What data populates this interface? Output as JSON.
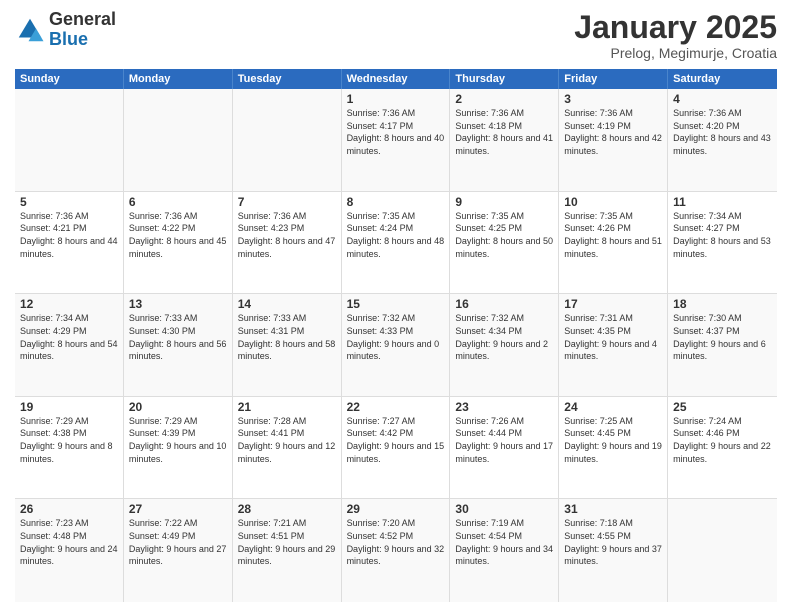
{
  "header": {
    "logo_line1": "General",
    "logo_line2": "Blue",
    "title": "January 2025",
    "subtitle": "Prelog, Megimurje, Croatia"
  },
  "days_of_week": [
    "Sunday",
    "Monday",
    "Tuesday",
    "Wednesday",
    "Thursday",
    "Friday",
    "Saturday"
  ],
  "weeks": [
    [
      {
        "day": "",
        "sunrise": "",
        "sunset": "",
        "daylight": ""
      },
      {
        "day": "",
        "sunrise": "",
        "sunset": "",
        "daylight": ""
      },
      {
        "day": "",
        "sunrise": "",
        "sunset": "",
        "daylight": ""
      },
      {
        "day": "1",
        "sunrise": "Sunrise: 7:36 AM",
        "sunset": "Sunset: 4:17 PM",
        "daylight": "Daylight: 8 hours and 40 minutes."
      },
      {
        "day": "2",
        "sunrise": "Sunrise: 7:36 AM",
        "sunset": "Sunset: 4:18 PM",
        "daylight": "Daylight: 8 hours and 41 minutes."
      },
      {
        "day": "3",
        "sunrise": "Sunrise: 7:36 AM",
        "sunset": "Sunset: 4:19 PM",
        "daylight": "Daylight: 8 hours and 42 minutes."
      },
      {
        "day": "4",
        "sunrise": "Sunrise: 7:36 AM",
        "sunset": "Sunset: 4:20 PM",
        "daylight": "Daylight: 8 hours and 43 minutes."
      }
    ],
    [
      {
        "day": "5",
        "sunrise": "Sunrise: 7:36 AM",
        "sunset": "Sunset: 4:21 PM",
        "daylight": "Daylight: 8 hours and 44 minutes."
      },
      {
        "day": "6",
        "sunrise": "Sunrise: 7:36 AM",
        "sunset": "Sunset: 4:22 PM",
        "daylight": "Daylight: 8 hours and 45 minutes."
      },
      {
        "day": "7",
        "sunrise": "Sunrise: 7:36 AM",
        "sunset": "Sunset: 4:23 PM",
        "daylight": "Daylight: 8 hours and 47 minutes."
      },
      {
        "day": "8",
        "sunrise": "Sunrise: 7:35 AM",
        "sunset": "Sunset: 4:24 PM",
        "daylight": "Daylight: 8 hours and 48 minutes."
      },
      {
        "day": "9",
        "sunrise": "Sunrise: 7:35 AM",
        "sunset": "Sunset: 4:25 PM",
        "daylight": "Daylight: 8 hours and 50 minutes."
      },
      {
        "day": "10",
        "sunrise": "Sunrise: 7:35 AM",
        "sunset": "Sunset: 4:26 PM",
        "daylight": "Daylight: 8 hours and 51 minutes."
      },
      {
        "day": "11",
        "sunrise": "Sunrise: 7:34 AM",
        "sunset": "Sunset: 4:27 PM",
        "daylight": "Daylight: 8 hours and 53 minutes."
      }
    ],
    [
      {
        "day": "12",
        "sunrise": "Sunrise: 7:34 AM",
        "sunset": "Sunset: 4:29 PM",
        "daylight": "Daylight: 8 hours and 54 minutes."
      },
      {
        "day": "13",
        "sunrise": "Sunrise: 7:33 AM",
        "sunset": "Sunset: 4:30 PM",
        "daylight": "Daylight: 8 hours and 56 minutes."
      },
      {
        "day": "14",
        "sunrise": "Sunrise: 7:33 AM",
        "sunset": "Sunset: 4:31 PM",
        "daylight": "Daylight: 8 hours and 58 minutes."
      },
      {
        "day": "15",
        "sunrise": "Sunrise: 7:32 AM",
        "sunset": "Sunset: 4:33 PM",
        "daylight": "Daylight: 9 hours and 0 minutes."
      },
      {
        "day": "16",
        "sunrise": "Sunrise: 7:32 AM",
        "sunset": "Sunset: 4:34 PM",
        "daylight": "Daylight: 9 hours and 2 minutes."
      },
      {
        "day": "17",
        "sunrise": "Sunrise: 7:31 AM",
        "sunset": "Sunset: 4:35 PM",
        "daylight": "Daylight: 9 hours and 4 minutes."
      },
      {
        "day": "18",
        "sunrise": "Sunrise: 7:30 AM",
        "sunset": "Sunset: 4:37 PM",
        "daylight": "Daylight: 9 hours and 6 minutes."
      }
    ],
    [
      {
        "day": "19",
        "sunrise": "Sunrise: 7:29 AM",
        "sunset": "Sunset: 4:38 PM",
        "daylight": "Daylight: 9 hours and 8 minutes."
      },
      {
        "day": "20",
        "sunrise": "Sunrise: 7:29 AM",
        "sunset": "Sunset: 4:39 PM",
        "daylight": "Daylight: 9 hours and 10 minutes."
      },
      {
        "day": "21",
        "sunrise": "Sunrise: 7:28 AM",
        "sunset": "Sunset: 4:41 PM",
        "daylight": "Daylight: 9 hours and 12 minutes."
      },
      {
        "day": "22",
        "sunrise": "Sunrise: 7:27 AM",
        "sunset": "Sunset: 4:42 PM",
        "daylight": "Daylight: 9 hours and 15 minutes."
      },
      {
        "day": "23",
        "sunrise": "Sunrise: 7:26 AM",
        "sunset": "Sunset: 4:44 PM",
        "daylight": "Daylight: 9 hours and 17 minutes."
      },
      {
        "day": "24",
        "sunrise": "Sunrise: 7:25 AM",
        "sunset": "Sunset: 4:45 PM",
        "daylight": "Daylight: 9 hours and 19 minutes."
      },
      {
        "day": "25",
        "sunrise": "Sunrise: 7:24 AM",
        "sunset": "Sunset: 4:46 PM",
        "daylight": "Daylight: 9 hours and 22 minutes."
      }
    ],
    [
      {
        "day": "26",
        "sunrise": "Sunrise: 7:23 AM",
        "sunset": "Sunset: 4:48 PM",
        "daylight": "Daylight: 9 hours and 24 minutes."
      },
      {
        "day": "27",
        "sunrise": "Sunrise: 7:22 AM",
        "sunset": "Sunset: 4:49 PM",
        "daylight": "Daylight: 9 hours and 27 minutes."
      },
      {
        "day": "28",
        "sunrise": "Sunrise: 7:21 AM",
        "sunset": "Sunset: 4:51 PM",
        "daylight": "Daylight: 9 hours and 29 minutes."
      },
      {
        "day": "29",
        "sunrise": "Sunrise: 7:20 AM",
        "sunset": "Sunset: 4:52 PM",
        "daylight": "Daylight: 9 hours and 32 minutes."
      },
      {
        "day": "30",
        "sunrise": "Sunrise: 7:19 AM",
        "sunset": "Sunset: 4:54 PM",
        "daylight": "Daylight: 9 hours and 34 minutes."
      },
      {
        "day": "31",
        "sunrise": "Sunrise: 7:18 AM",
        "sunset": "Sunset: 4:55 PM",
        "daylight": "Daylight: 9 hours and 37 minutes."
      },
      {
        "day": "",
        "sunrise": "",
        "sunset": "",
        "daylight": ""
      }
    ]
  ]
}
